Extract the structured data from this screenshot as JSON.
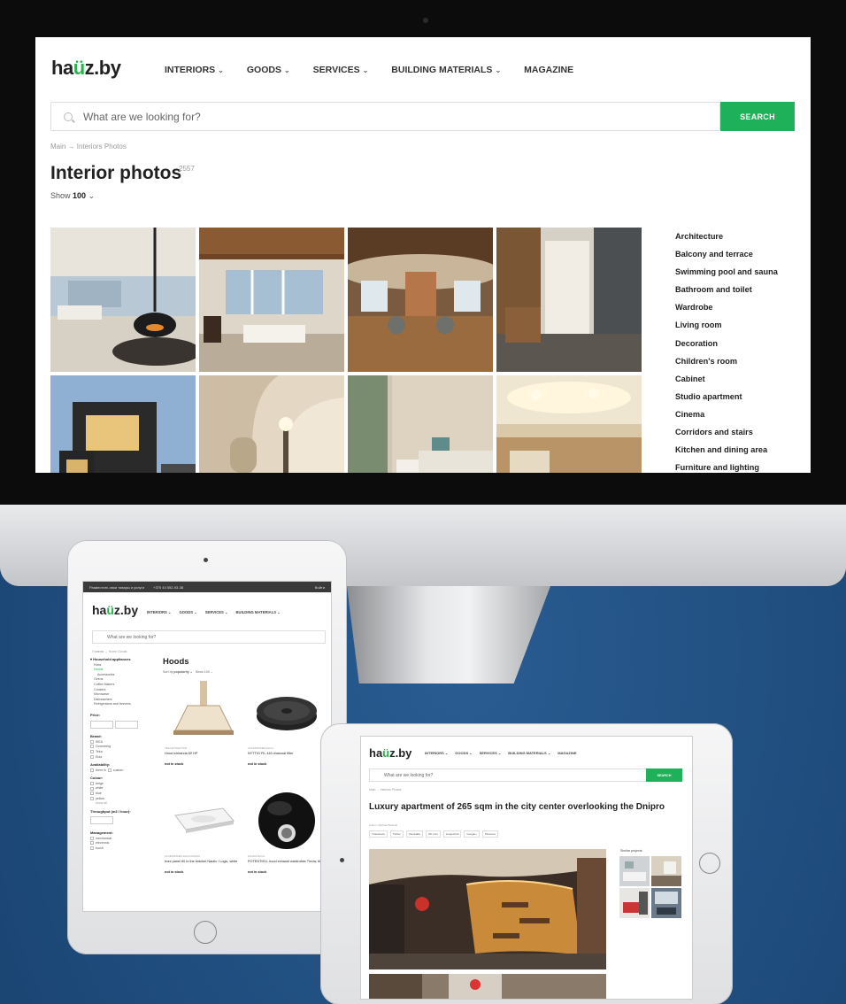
{
  "colors": {
    "background": "#1f4d7e",
    "accent": "#1fb15a",
    "text": "#222222"
  },
  "desktop": {
    "logo": {
      "pre": "ha",
      "mark": "ü",
      "post": "z.by"
    },
    "nav": [
      {
        "label": "INTERIORS",
        "caret": "⌄"
      },
      {
        "label": "GOODS",
        "caret": "⌄"
      },
      {
        "label": "SERVICES",
        "caret": "⌄"
      },
      {
        "label": "BUILDING MATERIALS",
        "caret": "⌄"
      },
      {
        "label": "MAGAZINE",
        "caret": ""
      }
    ],
    "search": {
      "placeholder": "What are we looking for?",
      "button": "SEARCH"
    },
    "breadcrumb": "Main → Interiors Photos",
    "title": "Interior photos",
    "count": "2557",
    "show": {
      "label": "Show",
      "value": "100",
      "caret": "⌄"
    },
    "categories": [
      "Architecture",
      "Balcony and terrace",
      "Swimming pool and sauna",
      "Bathroom and toilet",
      "Wardrobe",
      "Living room",
      "Decoration",
      "Children's room",
      "Cabinet",
      "Studio apartment",
      "Cinema",
      "Corridors and stairs",
      "Kitchen and dining area",
      "Furniture and lighting"
    ]
  },
  "tablet_portrait": {
    "topbar": {
      "left": "Разместить свои товары и услуги",
      "phone": "+375 44 552-93-38",
      "login": "Войти"
    },
    "logo": {
      "pre": "ha",
      "mark": "ü",
      "post": "z.by"
    },
    "nav": [
      "INTERIORS ⌄",
      "GOODS ⌄",
      "SERVICES ⌄",
      "BUILDING MATERIALS ⌄"
    ],
    "search": "What are we looking for?",
    "breadcrumb": "Главная → Home Goods",
    "sidebar": {
      "section": "▾ Household appliances",
      "items": [
        "Hobs",
        "Hoods",
        "Accessories",
        "Ovens",
        "Coffee Makers",
        "Cookers",
        "Microwave",
        "Dishwashers",
        "Refrigerators and freezers"
      ],
      "price": "Price:",
      "from": "от",
      "to": "до",
      "brand": "Brand:",
      "brands": [
        "IKEA",
        "Gorenberg",
        "Teka",
        "Elda"
      ],
      "availability": "Availability:",
      "avail": [
        "there is",
        "custom"
      ],
      "colour": "Colour:",
      "colours": [
        "beige",
        "white",
        "blue",
        "yellow",
        "show all"
      ],
      "throughput": "Throughput (m3 / hour):",
      "management": "Management:",
      "mgmt": [
        "mechanical",
        "electronic",
        "touch"
      ]
    },
    "title": "Hoods",
    "sort": {
      "label": "Sort by",
      "value": "popularity ⌄",
      "show": "Show 100 ⌄"
    },
    "products": [
      {
        "cat": "TEKA EXTRACTOR",
        "name": "Hood Ichiranda 60 HP",
        "status": "not in stock"
      },
      {
        "cat": "ACCESSORIES ELICA",
        "name": "NYTTIG FIL 440 charcoal filter",
        "status": "not in stock"
      },
      {
        "cat": "ACCESSORIES ELICA/HOODS",
        "name": "front panel 60 to the bracket Nautic / Logic, white",
        "status": "not in stock"
      },
      {
        "cat": "HOODS ELICA",
        "name": "POTENTIELL hood exhaust wardrobes Throw, black",
        "status": "not in stock"
      }
    ]
  },
  "tablet_landscape": {
    "logo": {
      "pre": "ha",
      "mark": "ü",
      "post": "z.by"
    },
    "nav": [
      "INTERIORS ⌄",
      "GOODS ⌄",
      "SERVICES ⌄",
      "BUILDING MATERIALS ⌄",
      "MAGAZINE"
    ],
    "search": {
      "placeholder": "What are we looking for?",
      "button": "SEARCH"
    },
    "breadcrumb": "Main → Interiors Photos",
    "title": "Luxury apartment of 265 sqm in the city center overlooking the Dnipro",
    "author": "Author: Michael Belinski",
    "share": [
      "f Facebook",
      "Twitter",
      "Vkontakte",
      "OK.com",
      "Livejournal",
      "Google+",
      "Pinterest"
    ],
    "similar": "Similar projects"
  }
}
